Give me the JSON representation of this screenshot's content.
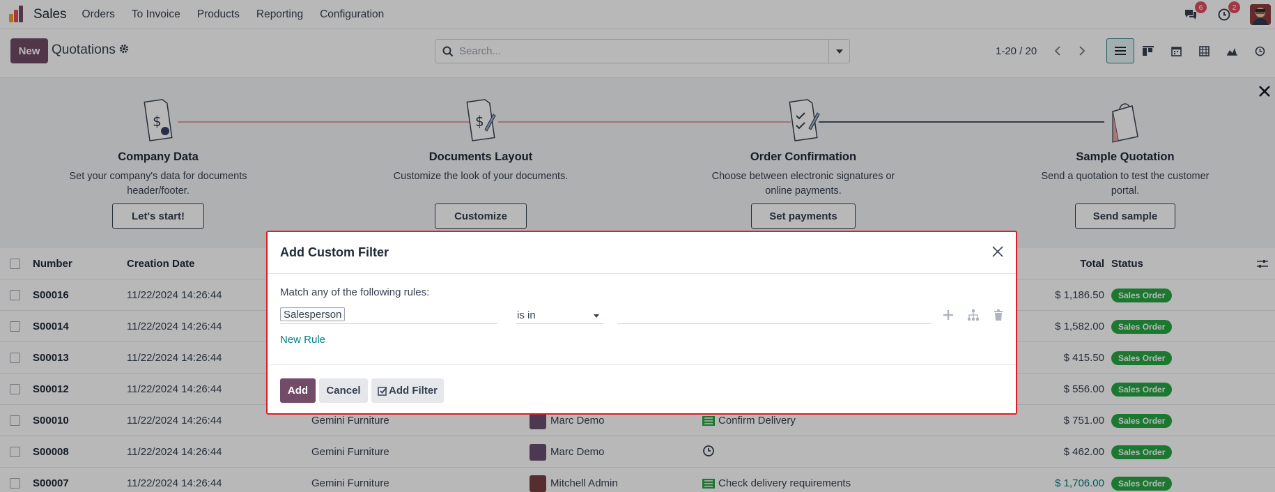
{
  "app": {
    "name": "Sales",
    "menu": [
      "Orders",
      "To Invoice",
      "Products",
      "Reporting",
      "Configuration"
    ],
    "chat_count": "6",
    "activity_count": "2"
  },
  "control_panel": {
    "new_label": "New",
    "title": "Quotations",
    "search_placeholder": "Search...",
    "pager": "1-20 / 20",
    "views": [
      "list-view-icon",
      "kanban-view-icon",
      "calendar-view-icon",
      "pivot-view-icon",
      "graph-view-icon",
      "activity-view-icon"
    ]
  },
  "onboarding": {
    "steps": [
      {
        "title": "Company Data",
        "desc1": "Set your company's data for documents",
        "desc2": "header/footer.",
        "button": "Let's start!"
      },
      {
        "title": "Documents Layout",
        "desc1": "Customize the look of your documents.",
        "desc2": "",
        "button": "Customize"
      },
      {
        "title": "Order Confirmation",
        "desc1": "Choose between electronic signatures or",
        "desc2": "online payments.",
        "button": "Set payments"
      },
      {
        "title": "Sample Quotation",
        "desc1": "Send a quotation to test the customer",
        "desc2": "portal.",
        "button": "Send sample"
      }
    ]
  },
  "table": {
    "headers": {
      "number": "Number",
      "creation_date": "Creation Date",
      "total": "Total",
      "status": "Status"
    },
    "rows": [
      {
        "number": "S00016",
        "date": "11/22/2024 14:26:44",
        "customer": "",
        "salesperson": "",
        "activity": "",
        "total": "$ 1,186.50",
        "status": "Sales Order"
      },
      {
        "number": "S00014",
        "date": "11/22/2024 14:26:44",
        "customer": "",
        "salesperson": "",
        "activity": "",
        "total": "$ 1,582.00",
        "status": "Sales Order"
      },
      {
        "number": "S00013",
        "date": "11/22/2024 14:26:44",
        "customer": "",
        "salesperson": "",
        "activity": "",
        "total": "$ 415.50",
        "status": "Sales Order"
      },
      {
        "number": "S00012",
        "date": "11/22/2024 14:26:44",
        "customer": "",
        "salesperson": "",
        "activity": "",
        "total": "$ 556.00",
        "status": "Sales Order"
      },
      {
        "number": "S00010",
        "date": "11/22/2024 14:26:44",
        "customer": "Gemini Furniture",
        "salesperson": "Marc Demo",
        "activity": "Confirm Delivery",
        "total": "$ 751.00",
        "status": "Sales Order"
      },
      {
        "number": "S00008",
        "date": "11/22/2024 14:26:44",
        "customer": "Gemini Furniture",
        "salesperson": "Marc Demo",
        "activity": "",
        "total": "$ 462.00",
        "status": "Sales Order"
      },
      {
        "number": "S00007",
        "date": "11/22/2024 14:26:44",
        "customer": "Gemini Furniture",
        "salesperson": "Mitchell Admin",
        "activity": "Check delivery requirements",
        "total": "$ 1,706.00",
        "status": "Sales Order"
      }
    ]
  },
  "modal": {
    "title": "Add Custom Filter",
    "rule_text": "Match any of the following rules:",
    "field": "Salesperson",
    "operator": "is in",
    "new_rule": "New Rule",
    "add_label": "Add",
    "cancel_label": "Cancel",
    "add_filter_label": "Add Filter"
  },
  "colors": {
    "brand": "#714b67",
    "status_green": "#28a745",
    "link_teal": "#017e84",
    "modal_highlight": "#e31b23"
  }
}
